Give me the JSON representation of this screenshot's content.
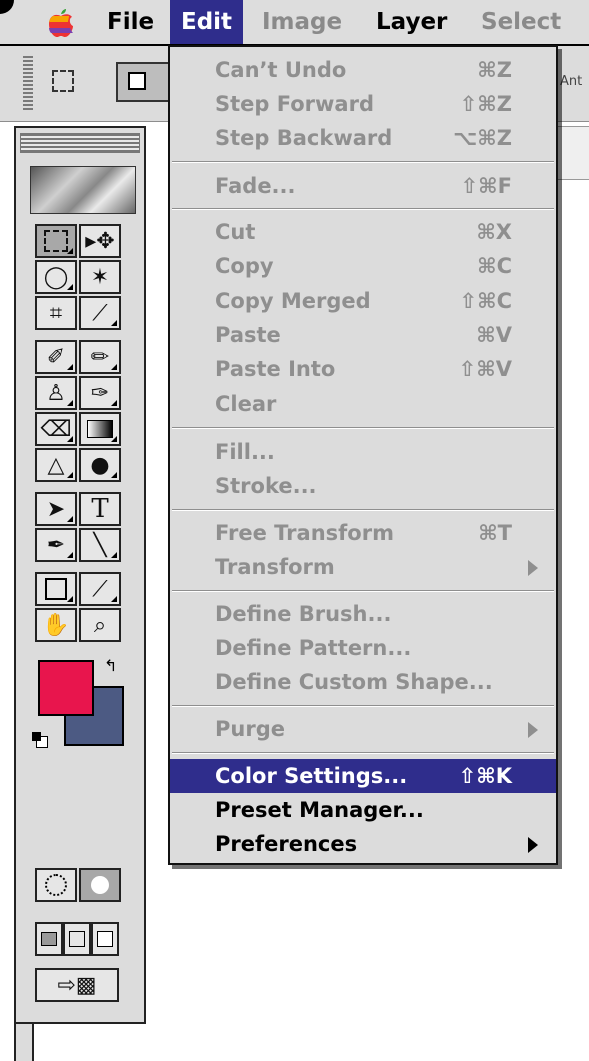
{
  "menubar": {
    "apple_icon": "apple-icon",
    "items": [
      {
        "label": "File"
      },
      {
        "label": "Edit"
      },
      {
        "label": "Image"
      },
      {
        "label": "Layer"
      },
      {
        "label": "Select"
      }
    ]
  },
  "options_bar": {
    "partial_label": "Ant"
  },
  "toolbox": {
    "tools": [
      {
        "name": "rect-marquee-tool",
        "icon": "⬚"
      },
      {
        "name": "move-tool",
        "icon": "➤"
      },
      {
        "name": "lasso-tool",
        "icon": "ℓ"
      },
      {
        "name": "magic-wand-tool",
        "icon": "✦"
      },
      {
        "name": "crop-tool",
        "icon": "⌗"
      },
      {
        "name": "slice-tool",
        "icon": "✎"
      },
      {
        "name": "healing-brush-tool",
        "icon": "✐"
      },
      {
        "name": "brush-tool",
        "icon": "✏"
      },
      {
        "name": "clone-stamp-tool",
        "icon": "♙"
      },
      {
        "name": "history-brush-tool",
        "icon": "✑"
      },
      {
        "name": "eraser-tool",
        "icon": "⌫"
      },
      {
        "name": "gradient-tool",
        "icon": "▦"
      },
      {
        "name": "blur-tool",
        "icon": "💧"
      },
      {
        "name": "dodge-tool",
        "icon": "●"
      },
      {
        "name": "path-selection-tool",
        "icon": "➤"
      },
      {
        "name": "type-tool",
        "icon": "T"
      },
      {
        "name": "pen-tool",
        "icon": "✒"
      },
      {
        "name": "line-tool",
        "icon": "╲"
      },
      {
        "name": "notes-tool",
        "icon": "▭"
      },
      {
        "name": "eyedropper-tool",
        "icon": "⟋"
      },
      {
        "name": "hand-tool",
        "icon": "✋"
      },
      {
        "name": "zoom-tool",
        "icon": "⌕"
      }
    ],
    "colors": {
      "foreground": "#e8154d",
      "background": "#4c5a83"
    }
  },
  "edit_menu": {
    "items": [
      {
        "label": "Can’t Undo",
        "shortcut": "⌘Z",
        "enabled": false
      },
      {
        "label": "Step Forward",
        "shortcut": "⇧⌘Z",
        "enabled": false
      },
      {
        "label": "Step Backward",
        "shortcut": "⌥⌘Z",
        "enabled": false
      },
      {
        "label": "Fade...",
        "shortcut": "⇧⌘F",
        "enabled": false
      },
      {
        "label": "Cut",
        "shortcut": "⌘X",
        "enabled": false
      },
      {
        "label": "Copy",
        "shortcut": "⌘C",
        "enabled": false
      },
      {
        "label": "Copy Merged",
        "shortcut": "⇧⌘C",
        "enabled": false
      },
      {
        "label": "Paste",
        "shortcut": "⌘V",
        "enabled": false
      },
      {
        "label": "Paste Into",
        "shortcut": "⇧⌘V",
        "enabled": false
      },
      {
        "label": "Clear",
        "shortcut": "",
        "enabled": false
      },
      {
        "label": "Fill...",
        "shortcut": "",
        "enabled": false
      },
      {
        "label": "Stroke...",
        "shortcut": "",
        "enabled": false
      },
      {
        "label": "Free Transform",
        "shortcut": "⌘T",
        "enabled": false
      },
      {
        "label": "Transform",
        "shortcut": "",
        "enabled": false,
        "submenu": true
      },
      {
        "label": "Define Brush...",
        "shortcut": "",
        "enabled": false
      },
      {
        "label": "Define Pattern...",
        "shortcut": "",
        "enabled": false
      },
      {
        "label": "Define Custom Shape...",
        "shortcut": "",
        "enabled": false
      },
      {
        "label": "Purge",
        "shortcut": "",
        "enabled": false,
        "submenu": true
      },
      {
        "label": "Color Settings...",
        "shortcut": "⇧⌘K",
        "enabled": true,
        "highlighted": true
      },
      {
        "label": "Preset Manager...",
        "shortcut": "",
        "enabled": true
      },
      {
        "label": "Preferences",
        "shortcut": "",
        "enabled": true,
        "submenu": true
      }
    ]
  },
  "colors": {
    "menu_highlight": "#2f2d8c",
    "disabled_text": "#8f8f8f",
    "menu_bg": "#dcdcdc"
  }
}
